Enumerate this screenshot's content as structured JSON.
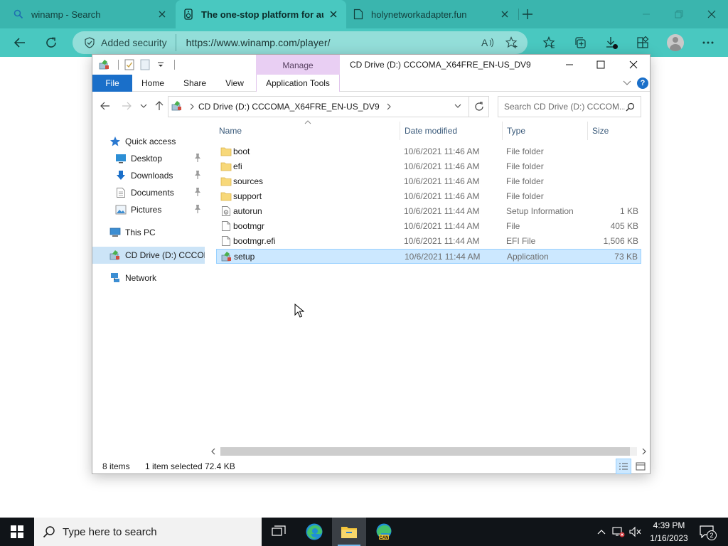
{
  "browser": {
    "tabs": [
      {
        "label": "winamp - Search",
        "icon": "search-icon"
      },
      {
        "label": "The one-stop platform for audio",
        "icon": "speaker-icon"
      },
      {
        "label": "holynetworkadapter.fun",
        "icon": "page-icon"
      }
    ],
    "security_label": "Added security",
    "url": "https://www.winamp.com/player/"
  },
  "explorer": {
    "manage_label": "Manage",
    "title": "CD Drive (D:) CCCOMA_X64FRE_EN-US_DV9",
    "ribbon_tabs": {
      "file": "File",
      "home": "Home",
      "share": "Share",
      "view": "View",
      "app_tools": "Application Tools"
    },
    "address": {
      "crumb": "CD Drive (D:) CCCOMA_X64FRE_EN-US_DV9"
    },
    "search_placeholder": "Search CD Drive (D:) CCCOM...",
    "nav": {
      "quick_access": "Quick access",
      "desktop": "Desktop",
      "downloads": "Downloads",
      "documents": "Documents",
      "pictures": "Pictures",
      "this_pc": "This PC",
      "cd_drive": "CD Drive (D:) CCCOMA",
      "network": "Network"
    },
    "columns": {
      "name": "Name",
      "date": "Date modified",
      "type": "Type",
      "size": "Size"
    },
    "files": [
      {
        "name": "boot",
        "date": "10/6/2021 11:46 AM",
        "type": "File folder",
        "size": "",
        "icon": "folder-icon"
      },
      {
        "name": "efi",
        "date": "10/6/2021 11:46 AM",
        "type": "File folder",
        "size": "",
        "icon": "folder-icon"
      },
      {
        "name": "sources",
        "date": "10/6/2021 11:46 AM",
        "type": "File folder",
        "size": "",
        "icon": "folder-icon"
      },
      {
        "name": "support",
        "date": "10/6/2021 11:46 AM",
        "type": "File folder",
        "size": "",
        "icon": "folder-icon"
      },
      {
        "name": "autorun",
        "date": "10/6/2021 11:44 AM",
        "type": "Setup Information",
        "size": "1 KB",
        "icon": "setup-info-icon"
      },
      {
        "name": "bootmgr",
        "date": "10/6/2021 11:44 AM",
        "type": "File",
        "size": "405 KB",
        "icon": "file-icon"
      },
      {
        "name": "bootmgr.efi",
        "date": "10/6/2021 11:44 AM",
        "type": "EFI File",
        "size": "1,506 KB",
        "icon": "file-icon"
      },
      {
        "name": "setup",
        "date": "10/6/2021 11:44 AM",
        "type": "Application",
        "size": "73 KB",
        "icon": "setup-app-icon",
        "selected": true
      }
    ],
    "status": {
      "items": "8 items",
      "selected": "1 item selected",
      "size": "72.4 KB"
    }
  },
  "taskbar": {
    "search_placeholder": "Type here to search",
    "time": "4:39 PM",
    "date": "1/16/2023",
    "notification_count": "2"
  },
  "colors": {
    "browser_accent": "#3ab5ae",
    "explorer_file_tab": "#1a6fc9",
    "manage_tab": "#e9cff3",
    "selection": "#cce8ff",
    "folder": "#f7d87a"
  }
}
